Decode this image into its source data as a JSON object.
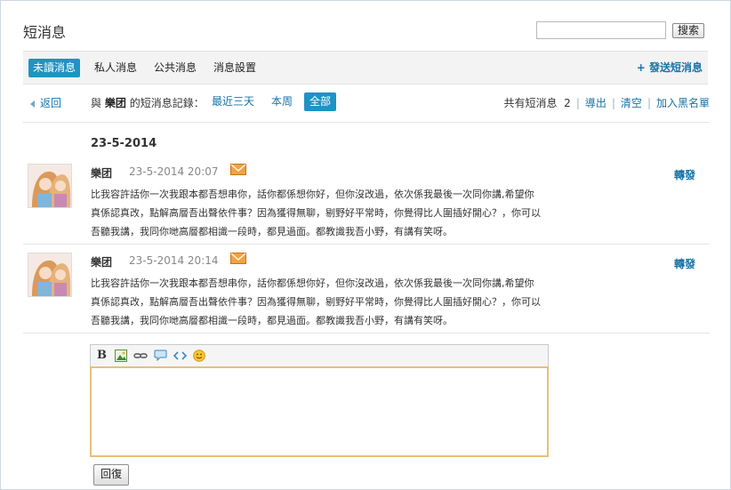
{
  "page": {
    "title": "短消息"
  },
  "search": {
    "placeholder": "",
    "button_label": "搜索"
  },
  "tabs": [
    {
      "label": "未讀消息",
      "active": true
    },
    {
      "label": "私人消息",
      "active": false
    },
    {
      "label": "公共消息",
      "active": false
    },
    {
      "label": "消息設置",
      "active": false
    }
  ],
  "compose_label": "+ 發送短消息",
  "filter": {
    "back_label": "返回",
    "prefix": "與",
    "contact": "樂团",
    "suffix": "的短消息記錄：",
    "ranges": [
      {
        "label": "最近三天",
        "active": false
      },
      {
        "label": "本周",
        "active": false
      },
      {
        "label": "全部",
        "active": true
      }
    ],
    "total_label": "共有短消息",
    "total_count": "2",
    "export_label": "導出",
    "clear_label": "清空",
    "blacklist_label": "加入黑名單"
  },
  "date_heading": "23-5-2014",
  "messages": [
    {
      "sender": "樂团",
      "timestamp": "23-5-2014 20:07",
      "forward_label": "轉發",
      "lines": [
        "比我容許話你一次我跟本都吾想串你，話你都係想你好，但你沒改過，依次係我最後一次同你講,希望你",
        "真係認真改，點解高層吾出聲依件事？因為獲得無聊，剔野好平常時，你覺得比人圍插好開心？，你可以",
        "吾聽我講，我同你哋高層都相識一段時，都見過面。都教識我吾小野，有講有笑呀。"
      ]
    },
    {
      "sender": "樂团",
      "timestamp": "23-5-2014 20:14",
      "forward_label": "轉發",
      "lines": [
        "比我容許話你一次我跟本都吾想串你，話你都係想你好，但你沒改過，依次係我最後一次同你講,希望你",
        "真係認真改，點解高層吾出聲依件事？因為獲得無聊，剔野好平常時，你覺得比人圍插好開心？，你可以",
        "吾聽我講，我同你哋高層都相識一段時，都見過面。都教識我吾小野，有講有笑呀。"
      ]
    }
  ],
  "editor": {
    "toolbar_icons": [
      "bold-icon",
      "image-icon",
      "link-icon",
      "quote-icon",
      "code-icon",
      "smiley-icon"
    ],
    "value": ""
  },
  "reply_label": "回復",
  "colors": {
    "accent": "#1f93c3",
    "link": "#1873a8",
    "editor_border": "#e7c078"
  }
}
